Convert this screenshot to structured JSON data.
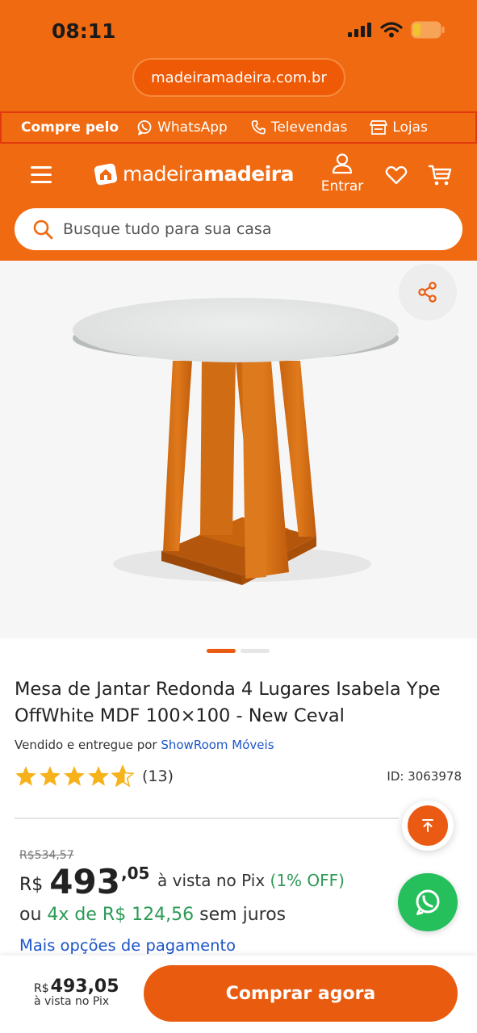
{
  "status_bar": {
    "time": "08:11"
  },
  "browser": {
    "url": "madeiramadeira.com.br"
  },
  "contact_bar": {
    "lead": "Compre pelo",
    "whatsapp": "WhatsApp",
    "televendas": "Televendas",
    "lojas": "Lojas"
  },
  "header": {
    "logo_light": "madeira",
    "logo_bold": "madeira",
    "login_label": "Entrar"
  },
  "search": {
    "placeholder": "Busque tudo para sua casa"
  },
  "gallery": {
    "slide_count": 2,
    "active_slide": 1
  },
  "product": {
    "title": "Mesa de Jantar Redonda 4 Lugares Isabela Ype OffWhite MDF 100×100 - New Ceval",
    "seller_prefix": "Vendido e entregue por",
    "seller_name": "ShowRoom Móveis",
    "rating_stars": 4.5,
    "rating_count": "(13)",
    "id_label": "ID: 3063978"
  },
  "pricing": {
    "old_price": "R$534,57",
    "currency": "R$",
    "price_int": "493",
    "price_cents": ",05",
    "pix_text": "à vista no Pix",
    "pix_discount": "(1% OFF)",
    "install_prefix": "ou",
    "install_terms": "4x de R$ 124,56",
    "install_suffix": "sem juros",
    "more_options": "Mais opções de pagamento"
  },
  "bottom_bar": {
    "currency": "R$",
    "price": "493,05",
    "sub": "à vista no Pix",
    "buy_label": "Comprar agora"
  },
  "colors": {
    "brand_orange": "#f06a12",
    "cta_orange": "#e95c10",
    "link_blue": "#1d56c7",
    "green": "#2c9a55",
    "whatsapp_green": "#25c05c",
    "star": "#f6b21b"
  }
}
